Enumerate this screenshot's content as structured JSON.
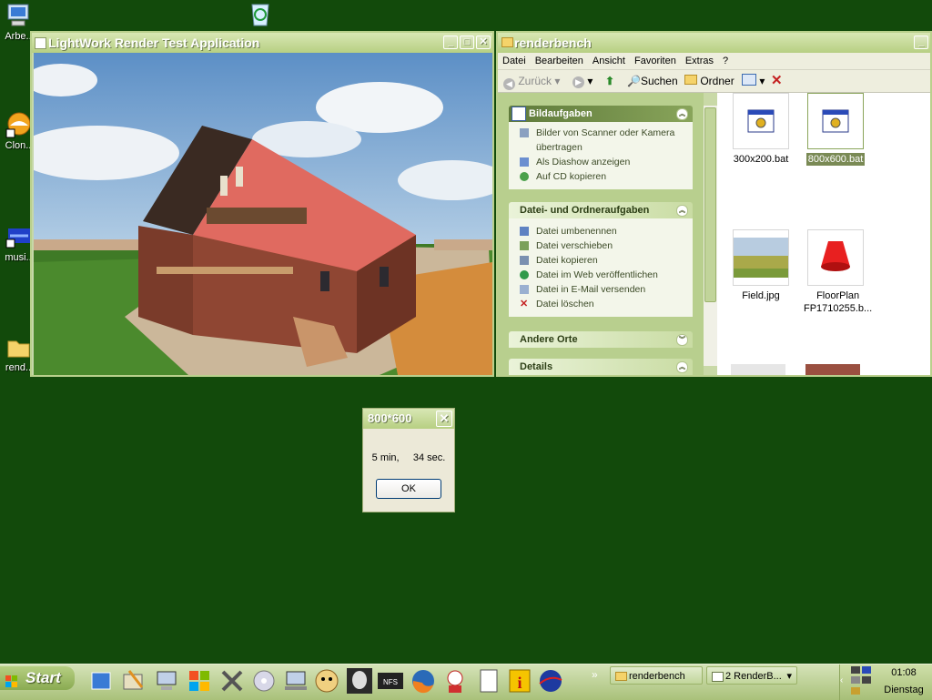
{
  "desktop": {
    "icons": [
      {
        "label": "Arbe..",
        "icon": "my-computer-icon"
      },
      {
        "label": "Clon..",
        "icon": "clone-app-icon"
      },
      {
        "label": "musi..",
        "icon": "music-app-icon"
      },
      {
        "label": "rend..",
        "icon": "folder-icon"
      }
    ],
    "recycle_icon": "recycle-bin-icon",
    "background_color": "#124a0b"
  },
  "render_window": {
    "title": "LightWork Render Test Application",
    "scene_icon": "house-render-image"
  },
  "explorer": {
    "title": "renderbench",
    "menu": [
      "Datei",
      "Bearbeiten",
      "Ansicht",
      "Favoriten",
      "Extras",
      "?"
    ],
    "toolbar": {
      "back": "Zurück",
      "search": "Suchen",
      "folders": "Ordner"
    },
    "panels": {
      "bildaufgaben": {
        "title": "Bildaufgaben",
        "items": [
          "Bilder von Scanner oder Kamera übertragen",
          "Als Diashow anzeigen",
          "Auf CD kopieren"
        ]
      },
      "dateiaufgaben": {
        "title": "Datei- und Ordneraufgaben",
        "items": [
          "Datei umbenennen",
          "Datei verschieben",
          "Datei kopieren",
          "Datei im Web veröffentlichen",
          "Datei in E-Mail versenden",
          "Datei löschen"
        ]
      },
      "andere_orte": {
        "title": "Andere Orte"
      },
      "details": {
        "title": "Details"
      }
    },
    "files": [
      {
        "name": "300x200.bat",
        "type": "batch"
      },
      {
        "name": "800x600.bat",
        "type": "batch",
        "selected": true
      },
      {
        "name": "Field.jpg",
        "type": "image"
      },
      {
        "name": "FloorPlan FP1710255.b...",
        "type": "image"
      }
    ]
  },
  "dialog": {
    "title": "800*600",
    "message": "5 min,     34 sec.",
    "ok": "OK"
  },
  "taskbar": {
    "start": "Start",
    "tasks": [
      {
        "label": "renderbench"
      },
      {
        "label": "2 RenderB..."
      }
    ],
    "clock": "01:08",
    "day": "Dienstag"
  },
  "colors": {
    "xp_olive_title": "#b7cf82",
    "selection": "#7a8a55"
  }
}
